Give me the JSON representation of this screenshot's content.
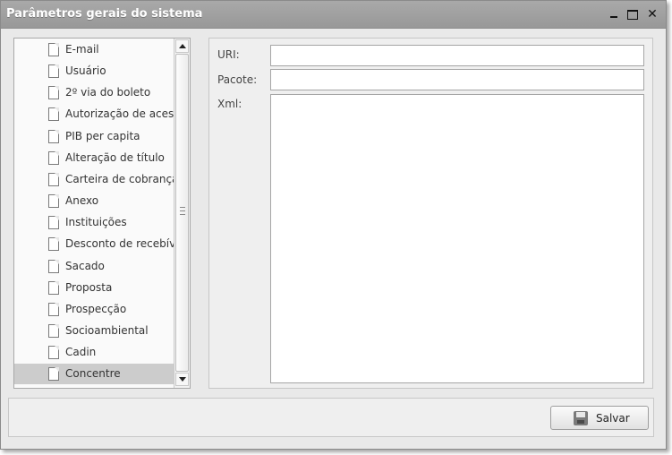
{
  "window": {
    "title": "Parâmetros gerais do sistema",
    "close_glyph": "✕"
  },
  "tree": {
    "items": [
      {
        "label": "E-mail"
      },
      {
        "label": "Usuário"
      },
      {
        "label": "2º via do boleto"
      },
      {
        "label": "Autorização de acesso"
      },
      {
        "label": "PIB per capita"
      },
      {
        "label": "Alteração de título"
      },
      {
        "label": "Carteira de cobrança"
      },
      {
        "label": "Anexo"
      },
      {
        "label": "Instituições"
      },
      {
        "label": "Desconto de recebíveis"
      },
      {
        "label": "Sacado"
      },
      {
        "label": "Proposta"
      },
      {
        "label": "Prospecção"
      },
      {
        "label": "Socioambiental"
      },
      {
        "label": "Cadin"
      },
      {
        "label": "Concentre"
      }
    ],
    "selected_index": 15
  },
  "form": {
    "uri_label": "URI:",
    "uri_value": "",
    "pacote_label": "Pacote:",
    "pacote_value": "",
    "xml_label": "Xml:",
    "xml_value": ""
  },
  "toolbar": {
    "save_label": "Salvar",
    "save_icon": "floppy-disk-icon"
  }
}
